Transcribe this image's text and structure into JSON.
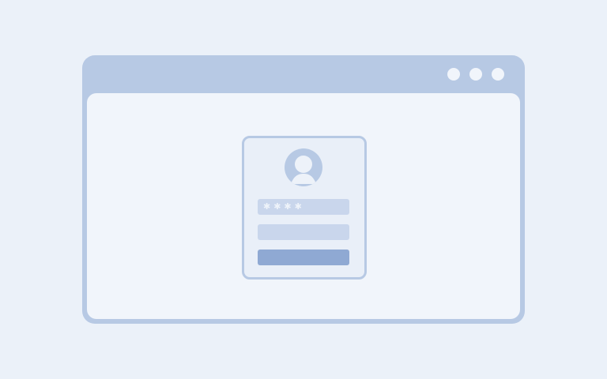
{
  "window": {
    "controls": [
      "circle-icon",
      "circle-icon",
      "circle-icon"
    ]
  },
  "login": {
    "avatar_icon": "user-avatar-icon",
    "password_mask": "✱✱✱✱",
    "username_value": "",
    "button_label": ""
  },
  "colors": {
    "background": "#ebf1f9",
    "frame": "#b7c9e4",
    "content": "#f1f5fb",
    "field": "#c9d6ec",
    "button": "#8fa9d3"
  }
}
